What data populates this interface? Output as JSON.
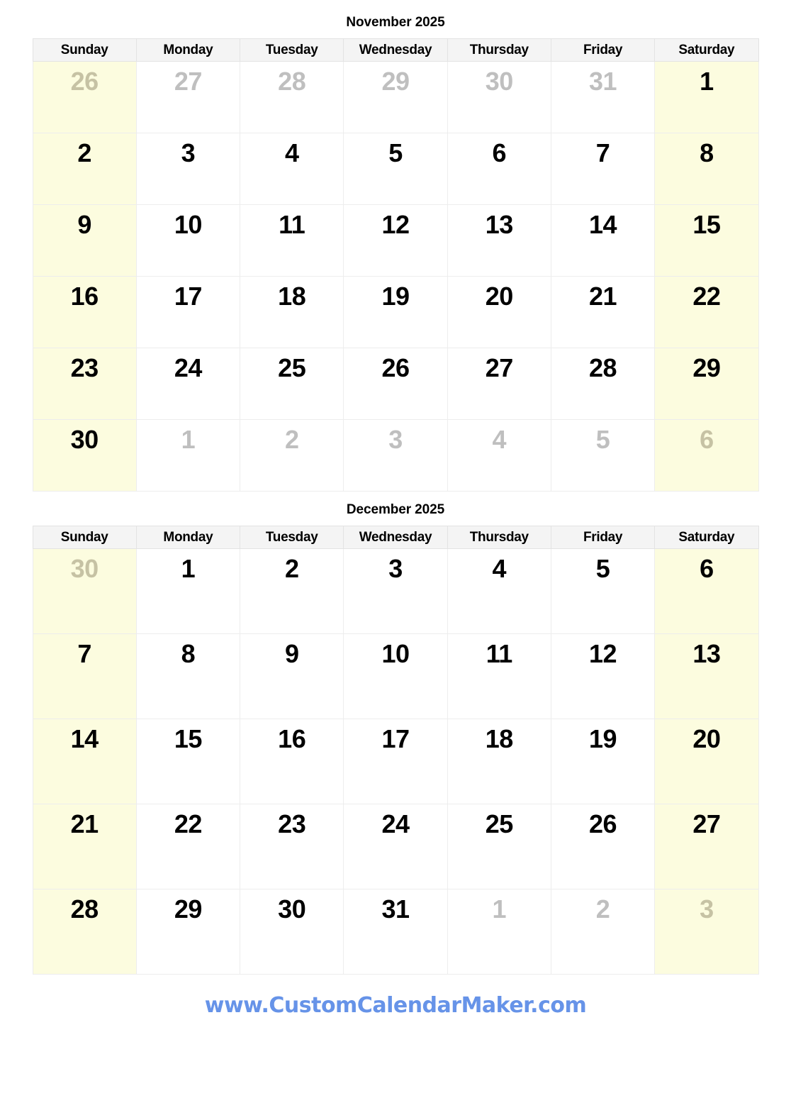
{
  "document": {
    "footer_url": "www.CustomCalendarMaker.com",
    "accent_color": "#6693e8",
    "weekend_bg": "#fcfcdf",
    "header_bg": "#f4f4f4",
    "muted_color": "#bfbfbf",
    "text_color": "#000000"
  },
  "weekday_headers": [
    "Sunday",
    "Monday",
    "Tuesday",
    "Wednesday",
    "Thursday",
    "Friday",
    "Saturday"
  ],
  "months": [
    {
      "title": "November 2025",
      "weeks": [
        [
          {
            "day": "26",
            "muted": true,
            "weekend": true
          },
          {
            "day": "27",
            "muted": true,
            "weekend": false
          },
          {
            "day": "28",
            "muted": true,
            "weekend": false
          },
          {
            "day": "29",
            "muted": true,
            "weekend": false
          },
          {
            "day": "30",
            "muted": true,
            "weekend": false
          },
          {
            "day": "31",
            "muted": true,
            "weekend": false
          },
          {
            "day": "1",
            "muted": false,
            "weekend": true
          }
        ],
        [
          {
            "day": "2",
            "muted": false,
            "weekend": true
          },
          {
            "day": "3",
            "muted": false,
            "weekend": false
          },
          {
            "day": "4",
            "muted": false,
            "weekend": false
          },
          {
            "day": "5",
            "muted": false,
            "weekend": false
          },
          {
            "day": "6",
            "muted": false,
            "weekend": false
          },
          {
            "day": "7",
            "muted": false,
            "weekend": false
          },
          {
            "day": "8",
            "muted": false,
            "weekend": true
          }
        ],
        [
          {
            "day": "9",
            "muted": false,
            "weekend": true
          },
          {
            "day": "10",
            "muted": false,
            "weekend": false
          },
          {
            "day": "11",
            "muted": false,
            "weekend": false
          },
          {
            "day": "12",
            "muted": false,
            "weekend": false
          },
          {
            "day": "13",
            "muted": false,
            "weekend": false
          },
          {
            "day": "14",
            "muted": false,
            "weekend": false
          },
          {
            "day": "15",
            "muted": false,
            "weekend": true
          }
        ],
        [
          {
            "day": "16",
            "muted": false,
            "weekend": true
          },
          {
            "day": "17",
            "muted": false,
            "weekend": false
          },
          {
            "day": "18",
            "muted": false,
            "weekend": false
          },
          {
            "day": "19",
            "muted": false,
            "weekend": false
          },
          {
            "day": "20",
            "muted": false,
            "weekend": false
          },
          {
            "day": "21",
            "muted": false,
            "weekend": false
          },
          {
            "day": "22",
            "muted": false,
            "weekend": true
          }
        ],
        [
          {
            "day": "23",
            "muted": false,
            "weekend": true
          },
          {
            "day": "24",
            "muted": false,
            "weekend": false
          },
          {
            "day": "25",
            "muted": false,
            "weekend": false
          },
          {
            "day": "26",
            "muted": false,
            "weekend": false
          },
          {
            "day": "27",
            "muted": false,
            "weekend": false
          },
          {
            "day": "28",
            "muted": false,
            "weekend": false
          },
          {
            "day": "29",
            "muted": false,
            "weekend": true
          }
        ],
        [
          {
            "day": "30",
            "muted": false,
            "weekend": true
          },
          {
            "day": "1",
            "muted": true,
            "weekend": false
          },
          {
            "day": "2",
            "muted": true,
            "weekend": false
          },
          {
            "day": "3",
            "muted": true,
            "weekend": false
          },
          {
            "day": "4",
            "muted": true,
            "weekend": false
          },
          {
            "day": "5",
            "muted": true,
            "weekend": false
          },
          {
            "day": "6",
            "muted": true,
            "weekend": true
          }
        ]
      ]
    },
    {
      "title": "December 2025",
      "weeks": [
        [
          {
            "day": "30",
            "muted": true,
            "weekend": true
          },
          {
            "day": "1",
            "muted": false,
            "weekend": false
          },
          {
            "day": "2",
            "muted": false,
            "weekend": false
          },
          {
            "day": "3",
            "muted": false,
            "weekend": false
          },
          {
            "day": "4",
            "muted": false,
            "weekend": false
          },
          {
            "day": "5",
            "muted": false,
            "weekend": false
          },
          {
            "day": "6",
            "muted": false,
            "weekend": true
          }
        ],
        [
          {
            "day": "7",
            "muted": false,
            "weekend": true
          },
          {
            "day": "8",
            "muted": false,
            "weekend": false
          },
          {
            "day": "9",
            "muted": false,
            "weekend": false
          },
          {
            "day": "10",
            "muted": false,
            "weekend": false
          },
          {
            "day": "11",
            "muted": false,
            "weekend": false
          },
          {
            "day": "12",
            "muted": false,
            "weekend": false
          },
          {
            "day": "13",
            "muted": false,
            "weekend": true
          }
        ],
        [
          {
            "day": "14",
            "muted": false,
            "weekend": true
          },
          {
            "day": "15",
            "muted": false,
            "weekend": false
          },
          {
            "day": "16",
            "muted": false,
            "weekend": false
          },
          {
            "day": "17",
            "muted": false,
            "weekend": false
          },
          {
            "day": "18",
            "muted": false,
            "weekend": false
          },
          {
            "day": "19",
            "muted": false,
            "weekend": false
          },
          {
            "day": "20",
            "muted": false,
            "weekend": true
          }
        ],
        [
          {
            "day": "21",
            "muted": false,
            "weekend": true
          },
          {
            "day": "22",
            "muted": false,
            "weekend": false
          },
          {
            "day": "23",
            "muted": false,
            "weekend": false
          },
          {
            "day": "24",
            "muted": false,
            "weekend": false
          },
          {
            "day": "25",
            "muted": false,
            "weekend": false
          },
          {
            "day": "26",
            "muted": false,
            "weekend": false
          },
          {
            "day": "27",
            "muted": false,
            "weekend": true
          }
        ],
        [
          {
            "day": "28",
            "muted": false,
            "weekend": true
          },
          {
            "day": "29",
            "muted": false,
            "weekend": false
          },
          {
            "day": "30",
            "muted": false,
            "weekend": false
          },
          {
            "day": "31",
            "muted": false,
            "weekend": false
          },
          {
            "day": "1",
            "muted": true,
            "weekend": false
          },
          {
            "day": "2",
            "muted": true,
            "weekend": false
          },
          {
            "day": "3",
            "muted": true,
            "weekend": true
          }
        ]
      ]
    }
  ]
}
